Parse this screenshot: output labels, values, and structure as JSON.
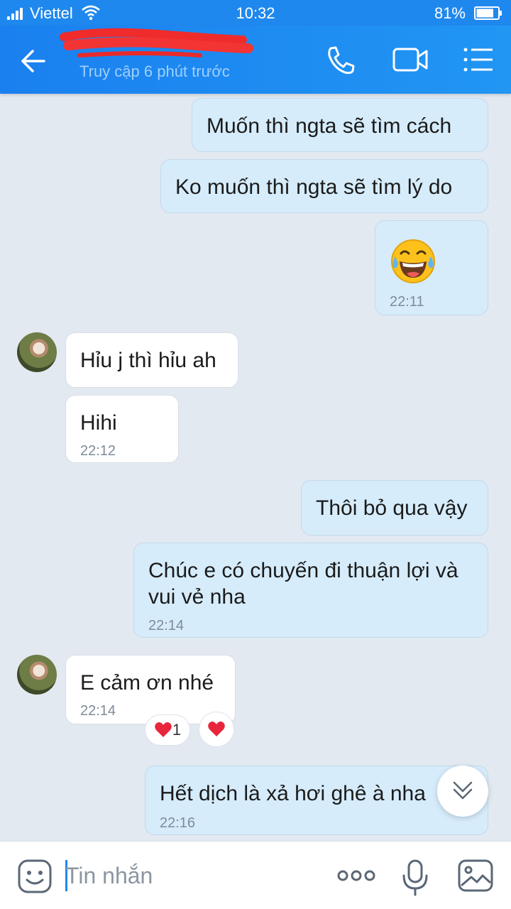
{
  "status_bar": {
    "carrier": "Viettel",
    "time": "10:32",
    "battery_percent": "81%",
    "battery_level": 0.81
  },
  "header": {
    "last_seen": "Truy cập 6 phút trước",
    "icons": [
      "back-arrow-icon",
      "phone-icon",
      "video-camera-icon",
      "menu-list-icon"
    ]
  },
  "messages": [
    {
      "direction": "out",
      "text": "Muốn thì ngta sẽ tìm cách"
    },
    {
      "direction": "out",
      "text": "Ko muốn thì ngta sẽ tìm lý do"
    },
    {
      "direction": "out",
      "emoji": "tears-of-joy-emoji",
      "time": "22:11"
    },
    {
      "direction": "in",
      "text": "Hỉu j thì hỉu ah"
    },
    {
      "direction": "in",
      "text": "Hihi",
      "time": "22:12"
    },
    {
      "direction": "out",
      "text": "Thôi bỏ qua vậy"
    },
    {
      "direction": "out",
      "text": "Chúc e có chuyến đi thuận lợi và vui vẻ nha",
      "time": "22:14"
    },
    {
      "direction": "in",
      "text": "E cảm ơn nhé",
      "time": "22:14",
      "reaction_count": "1"
    },
    {
      "direction": "out",
      "text": "Hết dịch là xả hơi ghê à nha",
      "time": "22:16"
    }
  ],
  "input": {
    "placeholder": "Tin nhắn"
  },
  "colors": {
    "header": "#1f88ef",
    "outgoing_bubble": "#d6ecfb",
    "incoming_bubble": "#ffffff",
    "background": "#e2e9f1",
    "heart": "#e8253b"
  }
}
